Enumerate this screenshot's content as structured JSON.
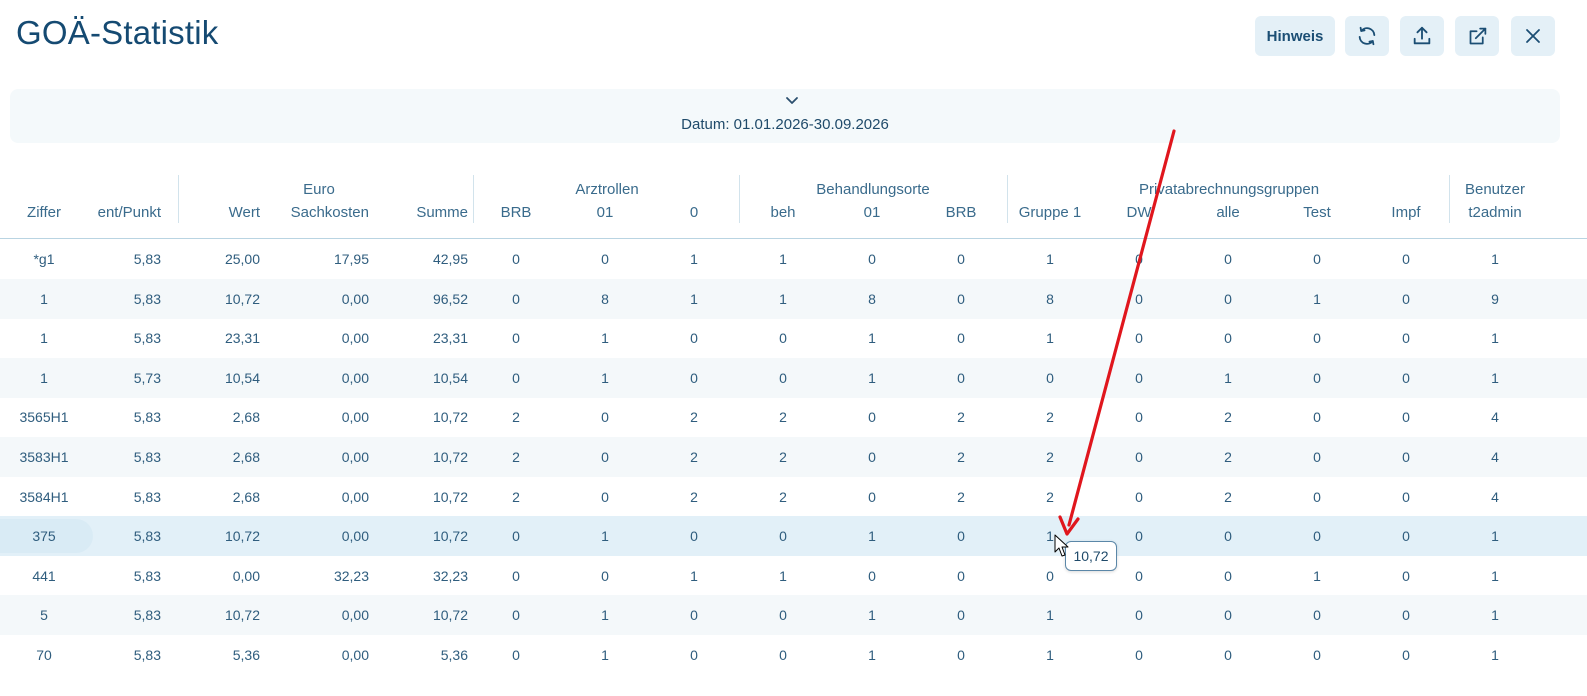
{
  "title": "GOÄ-Statistik",
  "toolbar": {
    "hint_label": "Hinweis",
    "icons": [
      "refresh-icon",
      "upload-icon",
      "external-link-icon",
      "close-icon"
    ]
  },
  "filter": {
    "datum": "Datum: 01.01.2026-30.09.2026"
  },
  "groups": {
    "euro": "Euro",
    "arztrollen": "Arztrollen",
    "behandlungsorte": "Behandlungsorte",
    "privat": "Privatabrechnungsgruppen",
    "benutzer": "Benutzer"
  },
  "columns": [
    "Ziffer",
    "ent/Punkt",
    "Wert",
    "Sachkosten",
    "Summe",
    "BRB",
    "01",
    "0",
    "beh",
    "01",
    "BRB",
    "Gruppe 1",
    "DW",
    "alle",
    "Test",
    "Impf",
    "t2admin"
  ],
  "rows": [
    [
      "*g1",
      "5,83",
      "25,00",
      "17,95",
      "42,95",
      "0",
      "0",
      "1",
      "1",
      "0",
      "0",
      "1",
      "0",
      "0",
      "0",
      "0",
      "1"
    ],
    [
      "1",
      "5,83",
      "10,72",
      "0,00",
      "96,52",
      "0",
      "8",
      "1",
      "1",
      "8",
      "0",
      "8",
      "0",
      "0",
      "1",
      "0",
      "9"
    ],
    [
      "1",
      "5,83",
      "23,31",
      "0,00",
      "23,31",
      "0",
      "1",
      "0",
      "0",
      "1",
      "0",
      "1",
      "0",
      "0",
      "0",
      "0",
      "1"
    ],
    [
      "1",
      "5,73",
      "10,54",
      "0,00",
      "10,54",
      "0",
      "1",
      "0",
      "0",
      "1",
      "0",
      "0",
      "0",
      "1",
      "0",
      "0",
      "1"
    ],
    [
      "3565H1",
      "5,83",
      "2,68",
      "0,00",
      "10,72",
      "2",
      "0",
      "2",
      "2",
      "0",
      "2",
      "2",
      "0",
      "2",
      "0",
      "0",
      "4"
    ],
    [
      "3583H1",
      "5,83",
      "2,68",
      "0,00",
      "10,72",
      "2",
      "0",
      "2",
      "2",
      "0",
      "2",
      "2",
      "0",
      "2",
      "0",
      "0",
      "4"
    ],
    [
      "3584H1",
      "5,83",
      "2,68",
      "0,00",
      "10,72",
      "2",
      "0",
      "2",
      "2",
      "0",
      "2",
      "2",
      "0",
      "2",
      "0",
      "0",
      "4"
    ],
    [
      "375",
      "5,83",
      "10,72",
      "0,00",
      "10,72",
      "0",
      "1",
      "0",
      "0",
      "1",
      "0",
      "1",
      "0",
      "0",
      "0",
      "0",
      "1"
    ],
    [
      "441",
      "5,83",
      "0,00",
      "32,23",
      "32,23",
      "0",
      "0",
      "1",
      "1",
      "0",
      "0",
      "0",
      "0",
      "0",
      "1",
      "0",
      "1"
    ],
    [
      "5",
      "5,83",
      "10,72",
      "0,00",
      "10,72",
      "0",
      "1",
      "0",
      "0",
      "1",
      "0",
      "1",
      "0",
      "0",
      "0",
      "0",
      "1"
    ],
    [
      "70",
      "5,83",
      "5,36",
      "0,00",
      "5,36",
      "0",
      "1",
      "0",
      "0",
      "1",
      "0",
      "1",
      "0",
      "0",
      "0",
      "0",
      "1"
    ]
  ],
  "selected_row": 7,
  "tooltip": "10,72",
  "colors": {
    "title": "#154a72",
    "button_bg": "#e4f0f7",
    "row_alt": "#f4f8fa",
    "row_selected": "#e2f0f8",
    "annotation_arrow": "#e0161d"
  }
}
